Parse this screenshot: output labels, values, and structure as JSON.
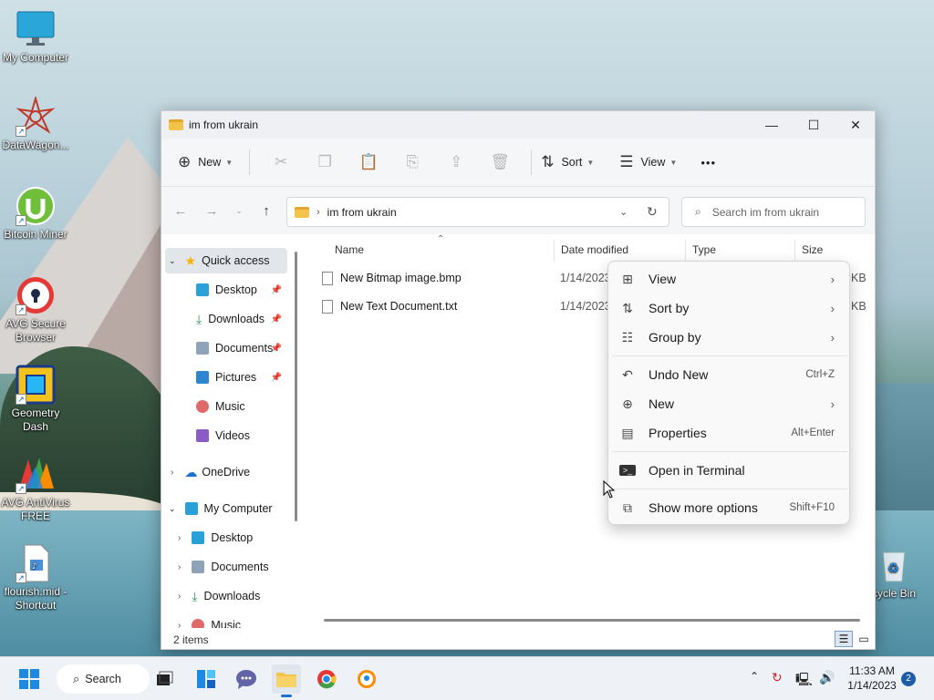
{
  "desktop": {
    "icons": [
      {
        "label": "My Computer"
      },
      {
        "label": "DataWagon..."
      },
      {
        "label": "Bitcoin Miner"
      },
      {
        "label": "AVG Secure Browser"
      },
      {
        "label": "Geometry Dash"
      },
      {
        "label": "AVG AntiVirus FREE"
      },
      {
        "label": "flourish.mid - Shortcut"
      },
      {
        "label": "cycle Bin"
      }
    ]
  },
  "window": {
    "title": "im from ukrain",
    "controls": {
      "minimize": "—",
      "maximize": "☐",
      "close": "✕"
    }
  },
  "toolbar": {
    "new_label": "New",
    "sort_label": "Sort",
    "view_label": "View",
    "more_label": "•••"
  },
  "address": {
    "path": "im from ukrain",
    "search_placeholder": "Search im from ukrain"
  },
  "nav": {
    "items": [
      {
        "label": "Quick access"
      },
      {
        "label": "Desktop"
      },
      {
        "label": "Downloads"
      },
      {
        "label": "Documents"
      },
      {
        "label": "Pictures"
      },
      {
        "label": "Music"
      },
      {
        "label": "Videos"
      },
      {
        "label": "OneDrive"
      },
      {
        "label": "My Computer"
      },
      {
        "label": "Desktop"
      },
      {
        "label": "Documents"
      },
      {
        "label": "Downloads"
      },
      {
        "label": "Music"
      }
    ]
  },
  "files": {
    "columns": {
      "name": "Name",
      "date": "Date modified",
      "type": "Type",
      "size": "Size"
    },
    "rows": [
      {
        "name": "New Bitmap image.bmp",
        "date": "1/14/2023",
        "size": "KB"
      },
      {
        "name": "New Text Document.txt",
        "date": "1/14/2023",
        "size": "KB"
      }
    ]
  },
  "status": {
    "items_count": "2 items"
  },
  "context_menu": {
    "items": [
      {
        "label": "View",
        "shortcut": ""
      },
      {
        "label": "Sort by",
        "shortcut": ""
      },
      {
        "label": "Group by",
        "shortcut": ""
      },
      {
        "label": "Undo New",
        "shortcut": "Ctrl+Z"
      },
      {
        "label": "New",
        "shortcut": ""
      },
      {
        "label": "Properties",
        "shortcut": "Alt+Enter"
      },
      {
        "label": "Open in Terminal",
        "shortcut": ""
      },
      {
        "label": "Show more options",
        "shortcut": "Shift+F10"
      }
    ]
  },
  "taskbar": {
    "search_label": "Search",
    "time": "11:33 AM",
    "date": "1/14/2023",
    "notifications": "2"
  }
}
